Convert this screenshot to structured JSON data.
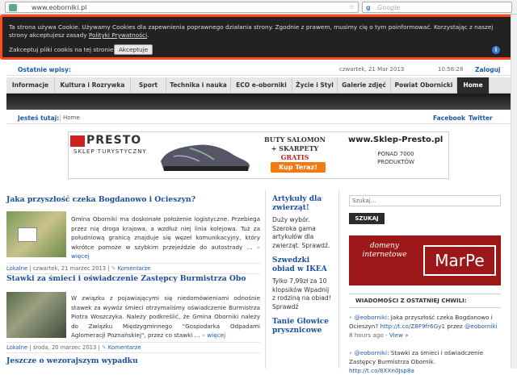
{
  "browser": {
    "url": "www.eoborniki.pl",
    "search_placeholder": "Google"
  },
  "cookie": {
    "text": "Ta strona używa Cookie. Używamy Cookies dla zapewnienia poprawnego działania strony. Zgodnie z prawem, musimy cię o tym poinformować. Korzystając z naszej strony akceptujesz zasady ",
    "link": "Polityki Prywatności",
    "link_tail": ".",
    "checkbox_label": "Zakceptuj pliki cookis na tej stronie",
    "accept_label": "Akceptuje",
    "info_icon": "i"
  },
  "topbar": {
    "recent_label": "Ostatnie wpisy:",
    "date": "czwartek, 21 Mar 2013",
    "time": "10:56:28",
    "login": "Zaloguj"
  },
  "nav": [
    {
      "label": "Informacje"
    },
    {
      "label": "Kultura i Rozrywka"
    },
    {
      "label": "Sport"
    },
    {
      "label": "Technika i nauka"
    },
    {
      "label": "ECO e-oborniki"
    },
    {
      "label": "Życie i Styl"
    },
    {
      "label": "Galerie zdjęć"
    },
    {
      "label": "Powiat Obornicki"
    },
    {
      "label": "Home"
    }
  ],
  "breadcrumb": {
    "label": "Jesteś tutaj:",
    "current": "Home",
    "facebook": "Facebook",
    "twitter": "Twitter"
  },
  "banner": {
    "brand": "PRESTO",
    "brand_sub": "SKLEP TURYSTYCZNY",
    "slogan_1": "BUTY SALOMON",
    "slogan_2": "+ SKARPETY",
    "slogan_gratis": "GRATIS",
    "cta": "Kup Teraz!",
    "website": "www.Sklep-Presto.pl",
    "ponad_1": "PONAD 7000",
    "ponad_2": "PRODUKTÓW"
  },
  "articles": [
    {
      "title": "Jaka przyszłość czeka Bogdanowo i Ocieszyn?",
      "body": "Gmina Oborniki ma doskonałe położenie logistyczne. Przebiega przez nią droga krajowa, a wzdłuż niej linia kolejowa. Tuż za południową granicą znajduje się węzeł komunikacyjny, który wkrótce pomoże w szybkim przejeździe do autostrady ...",
      "more": "więcej",
      "category": "Lokalne",
      "date": "czwartek, 21 marzec 2013",
      "comments": "Komentarze"
    },
    {
      "title": "Stawki za śmieci i oświadczenie Zastępcy Burmistrza Obo",
      "body": "W związku z pojawiającymi się niedomówieniami odnośnie stawek za wywóz śmieci otrzymaliśmy oświadczenie Burmistrza Piotra Woszczyka. Należy podkreślić, że Gmina Oborniki należy do Związku Międzygminnego \"Gospodarka Odpadami Aglomeracji Poznańskiej\", przez co stawki ...",
      "more": "więcej",
      "category": "Lokalne",
      "date": "środa, 20 marzec 2013",
      "comments": "Komentarze"
    },
    {
      "title": "Jeszcze o wezorajszym wypadku"
    }
  ],
  "middle": [
    {
      "title": "Artykuły dla zwierząt!",
      "text": "Duży wybór. Szeroka gama artykułów dla zwierząt. Sprawdź."
    },
    {
      "title": "Szwedzki obiad w IKEA",
      "text": "Tylko 7,99zł za 10 klopsików Wpadnij z rodziną na obiad! Sprawdź"
    },
    {
      "title": "Tanie Głowice prysznicowe"
    }
  ],
  "sidebar": {
    "search_placeholder": "Szukaj...",
    "search_button": "SZUKAJ",
    "ad_left": "domeny internetowe",
    "ad_right": "MarPe",
    "news_title": "WIADOMOŚCI Z OSTATNIEJ CHWILI:",
    "tweets": [
      {
        "handle": "@eoborniki",
        "text": ": Jaka przyszłość czeka Bogdanowo i Ocieszyn? ",
        "link": "http://t.co/Z8F9fr6Gy1",
        "via": " przez ",
        "via_handle": "@eoborniki",
        "time": "8 hours ago - ",
        "view": "View »"
      },
      {
        "handle": "@eoborniki",
        "text": ": Stawki za śmieci i oświadczenie Zastępcy Burmistrza Obornik. ",
        "link": "http://t.co/8XXn0Jsp8a"
      }
    ]
  },
  "colors": {
    "accent_border": "#ff4a1c",
    "link": "#1a5aa8",
    "title": "#1a4f9c",
    "nav_active": "#2a2a2a",
    "ad_bg": "#9c1818"
  }
}
